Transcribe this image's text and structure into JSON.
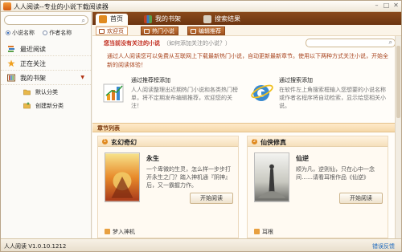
{
  "window": {
    "title": "人人阅读--专业的小说下载阅读器",
    "min_glyph": "–",
    "max_glyph": "□",
    "close_glyph": "✕"
  },
  "left_panel": {
    "search": {
      "placeholder": "",
      "value": ""
    },
    "radios": [
      {
        "label": "小说名称",
        "checked": true
      },
      {
        "label": "作者名称",
        "checked": false
      }
    ],
    "nav": [
      {
        "label": "最近阅读",
        "icon": "book-stack-icon"
      },
      {
        "label": "正在关注",
        "icon": "star-icon"
      },
      {
        "label": "我的书架",
        "icon": "bookshelf-icon"
      }
    ],
    "sub_items": [
      {
        "label": "默认分类",
        "icon": "folder-icon"
      },
      {
        "label": "创建新分类",
        "icon": "new-folder-icon"
      }
    ],
    "expand_glyph": "▼"
  },
  "tabs": [
    {
      "label": "首页",
      "active": true,
      "icon": "home-icon"
    },
    {
      "label": "我的书架",
      "active": false,
      "icon": "bookshelf-icon"
    },
    {
      "label": "搜索结果",
      "active": false,
      "icon": "search-results-icon"
    }
  ],
  "subtabs": [
    {
      "label": "欢迎页",
      "active": true
    },
    {
      "label": "热门小说",
      "active": false
    },
    {
      "label": "编辑推荐",
      "active": false
    }
  ],
  "main_search": {
    "placeholder": "",
    "value": ""
  },
  "welcome": {
    "question": "您当前没有关注的小说",
    "question_hint": "（如何添加关注的小说？）",
    "intro": "通过人人阅读您可以免费从互联网上下载最新热门小说，自动更新最新章节。使用以下两种方式关注小说，开始全新的阅读体验！",
    "methods": [
      {
        "title": "通过推荐榜添加",
        "desc": "人人阅读整理出近期热门小说和各类热门榜单，将不定期发布编辑推荐，欢迎您的关注！",
        "icon": "chart-icon"
      },
      {
        "title": "通过搜索添加",
        "desc": "在软件左上角搜索框输入您想要的小说名称或作者名程序将自动检索，显示给您相关小说。",
        "icon": "browser-search-icon"
      }
    ]
  },
  "chapter_list": {
    "heading": "章节列表",
    "cards": [
      {
        "category": "玄幻奇幻",
        "book_title": "永生",
        "desc": "一个卑微的生灵，怎么样一步步打开永生之门？踏入神机通『阴神』后，又一霸握力作。",
        "button": "开始阅读",
        "author": "梦入神机",
        "cover_text": "永生",
        "badge": "1"
      },
      {
        "category": "仙侠修真",
        "book_title": "仙逆",
        "desc": "顺为凡，逆则仙，只在心中一念间……请看耳根作品《仙逆》",
        "button": "开始阅读",
        "author": "耳根",
        "cover_text": "仙逆",
        "badge": "2"
      }
    ]
  },
  "status": {
    "version": "人人阅读 V1.0.10.1212",
    "feedback": "错误反馈"
  },
  "colors": {
    "accent": "#7a3a10",
    "brand_orange": "#e08a20",
    "link_blue": "#1f6bbf",
    "warning_red": "#c0281a"
  }
}
